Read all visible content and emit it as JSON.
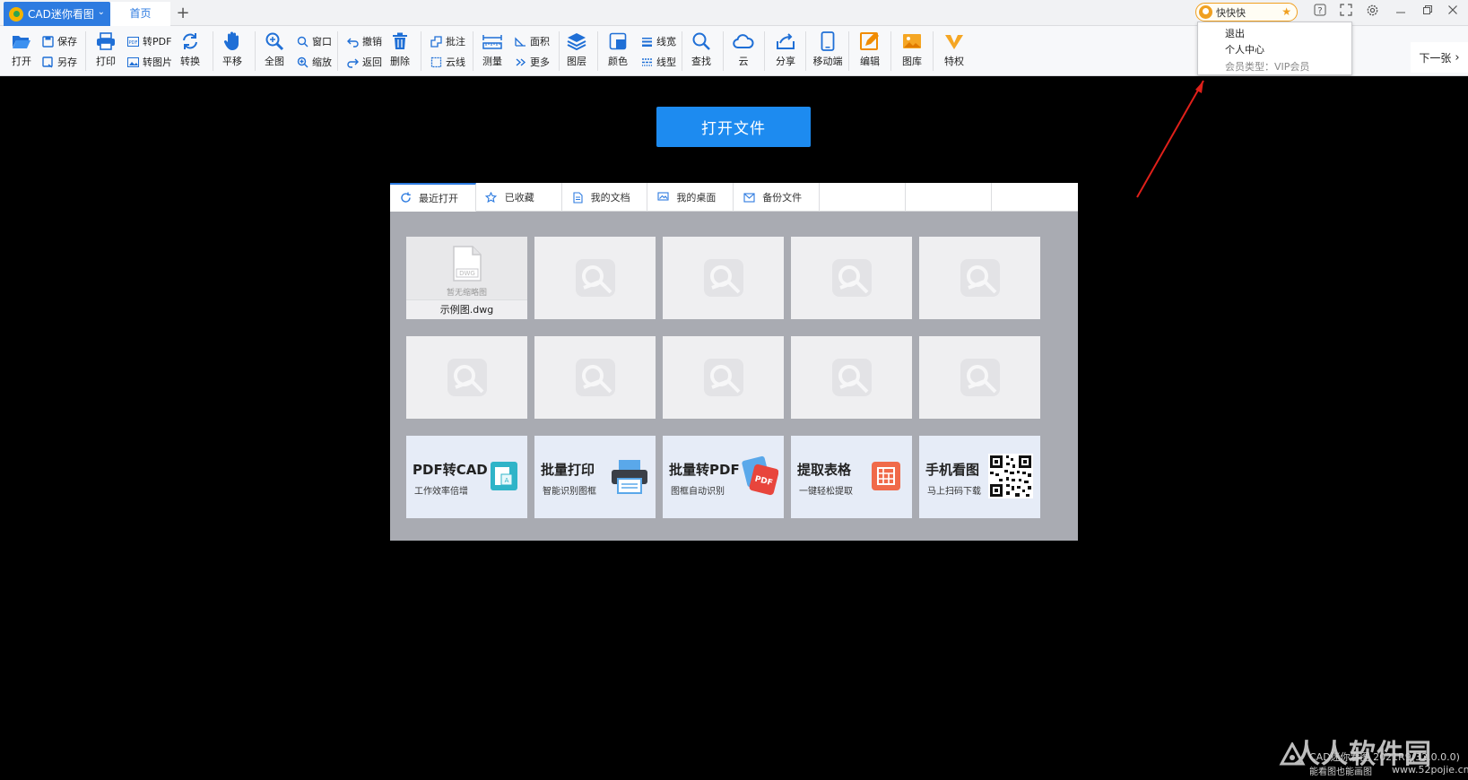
{
  "titlebar": {
    "app_name": "CAD迷你看图",
    "home_tab": "首页",
    "new_tab": "+",
    "username": "快快快"
  },
  "user_menu": {
    "logout": "退出",
    "profile": "个人中心",
    "member_type": "会员类型：VIP会员"
  },
  "toolbar": {
    "open": "打开",
    "save": "保存",
    "save_as": "另存",
    "print": "打印",
    "to_pdf": "转PDF",
    "to_image": "转图片",
    "convert": "转换",
    "pan": "平移",
    "fit_all": "全图",
    "window": "窗口",
    "zoom": "缩放",
    "undo": "撤销",
    "back": "返回",
    "delete": "删除",
    "annotate": "批注",
    "cloud_line": "云线",
    "measure": "测量",
    "area": "面积",
    "more": "更多",
    "layers": "图层",
    "color": "颜色",
    "line_width": "线宽",
    "line_type": "线型",
    "find": "查找",
    "cloud": "云",
    "share": "分享",
    "mobile": "移动端",
    "edit": "编辑",
    "gallery": "图库",
    "privilege": "特权",
    "next_page": "下一张"
  },
  "main": {
    "open_file": "打开文件"
  },
  "panel": {
    "tabs": [
      {
        "label": "最近打开"
      },
      {
        "label": "已收藏"
      },
      {
        "label": "我的文档"
      },
      {
        "label": "我的桌面"
      },
      {
        "label": "备份文件"
      },
      {
        "label": ""
      },
      {
        "label": ""
      },
      {
        "label": ""
      }
    ],
    "first_file": {
      "thumb_text": "暂无缩略图",
      "file_icon_text": "DWG",
      "name": "示例图.dwg"
    },
    "promos": [
      {
        "title": "PDF转CAD",
        "subtitle": "工作效率倍增"
      },
      {
        "title": "批量打印",
        "subtitle": "智能识别图框"
      },
      {
        "title": "批量转PDF",
        "subtitle": "图框自动识别",
        "badge": "PDF"
      },
      {
        "title": "提取表格",
        "subtitle": "一键轻松提取"
      },
      {
        "title": "手机看图",
        "subtitle": "马上扫码下载"
      }
    ]
  },
  "watermark": {
    "brand": "人人软件园",
    "line1": "CAD迷你看图 2021R9(32.0.0.0)",
    "line2": "能看图也能画图",
    "url": "www.52pojie.cn"
  },
  "colors": {
    "accent": "#2d7be0",
    "open_button": "#1d8bf0",
    "annotation_arrow": "#e0201a",
    "vip_gold": "#f0a020"
  }
}
